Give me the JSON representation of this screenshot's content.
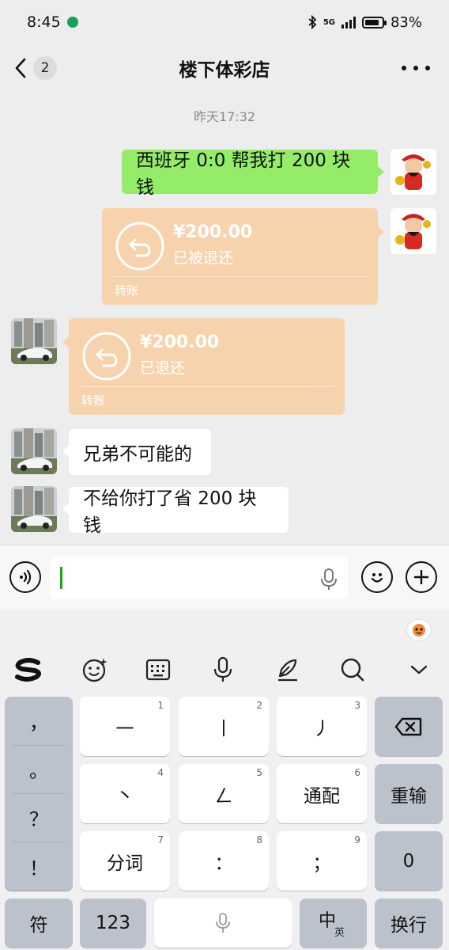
{
  "status_bar": {
    "time": "8:45",
    "network": "5G",
    "battery": "83%",
    "battery_level": 0.83
  },
  "nav": {
    "unread_count": "2",
    "title": "楼下体彩店"
  },
  "chat": {
    "timestamp": "昨天17:32",
    "messages": [
      {
        "sender": "self",
        "type": "text",
        "text": "西班牙 0:0 帮我打 200 块钱"
      },
      {
        "sender": "self",
        "type": "transfer",
        "amount": "¥200.00",
        "status": "已被退还",
        "kind": "转账"
      },
      {
        "sender": "other",
        "type": "transfer",
        "amount": "¥200.00",
        "status": "已退还",
        "kind": "转账"
      },
      {
        "sender": "other",
        "type": "text",
        "text": "兄弟不可能的"
      },
      {
        "sender": "other",
        "type": "text",
        "text": "不给你打了省 200 块钱"
      }
    ]
  },
  "input": {
    "value": ""
  },
  "keyboard": {
    "punctuation": [
      "，",
      "。",
      "？",
      "！"
    ],
    "rows": [
      [
        {
          "label": "一",
          "num": "1"
        },
        {
          "label": "丨",
          "num": "2"
        },
        {
          "label": "丿",
          "num": "3"
        }
      ],
      [
        {
          "label": "丶",
          "num": "4"
        },
        {
          "label": "ㄥ",
          "num": "5"
        },
        {
          "label": "通配",
          "num": "6"
        }
      ],
      [
        {
          "label": "分词",
          "num": "7"
        },
        {
          "label": "：",
          "num": "8"
        },
        {
          "label": "；",
          "num": "9"
        }
      ]
    ],
    "right_keys": [
      "重输",
      "0"
    ],
    "bottom": {
      "symbols": "符",
      "numbers": "123",
      "lang_main": "中",
      "lang_sub": "英",
      "enter": "换行"
    }
  },
  "colors": {
    "self_bubble": "#95ec69",
    "transfer": "#f7d3ad",
    "accent": "#1aad19"
  }
}
